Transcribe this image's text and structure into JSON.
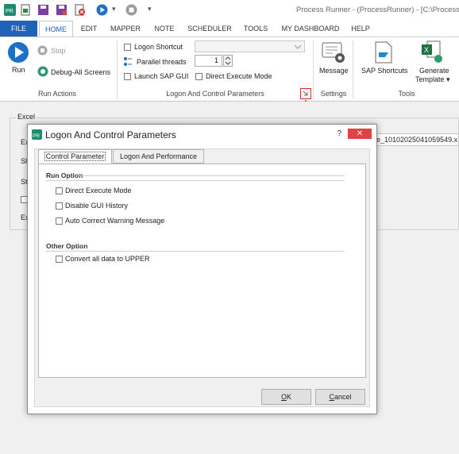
{
  "window": {
    "title": "Process Runner - (ProcessRunner) - [C:\\Process Runn"
  },
  "quick_access": {
    "icons": [
      "app-logo-icon",
      "new-file-icon",
      "save-icon",
      "save-as-icon",
      "delete-file-icon",
      "run-icon",
      "stop-icon",
      "customize-icon"
    ],
    "dropdown_glyph": "▾",
    "separator_glyph": "•"
  },
  "tabs": [
    "FILE",
    "HOME",
    "EDIT",
    "MAPPER",
    "NOTE",
    "SCHEDULER",
    "TOOLS",
    "MY DASHBOARD",
    "HELP"
  ],
  "ribbon": {
    "run_actions": {
      "label": "Run Actions",
      "run": "Run",
      "stop": "Stop",
      "debug": "Debug-All Screens"
    },
    "logon": {
      "label": "Logon And Control Parameters",
      "logon_shortcut": "Logon Shortcut",
      "parallel_threads": "Parallel threads",
      "threads_value": "1",
      "launch_sap_gui": "Launch SAP GUI",
      "direct_execute": "Direct Execute Mode"
    },
    "settings": {
      "label": "Settings",
      "message": "Message"
    },
    "tools": {
      "label": "Tools",
      "sap_shortcuts": "SAP Shortcuts",
      "generate_template": "Generate",
      "generate_template2": "Template ▾"
    }
  },
  "workspace": {
    "group_label": "Excel",
    "row_labels": [
      "Ex",
      "Sh",
      "St",
      "",
      "Ex"
    ],
    "file_text": "ne_10102025041059549.x"
  },
  "dialog": {
    "title": "Logon And Control Parameters",
    "help": "?",
    "close": "✕",
    "tabs": [
      "Control Parameter",
      "Logon And Performance"
    ],
    "run_option": {
      "title": "Run Option",
      "items": [
        "Direct Execute Mode",
        "Disable GUI History",
        "Auto Correct Warning Message"
      ]
    },
    "other_option": {
      "title": "Other Option",
      "items": [
        "Convert all data to UPPER"
      ]
    },
    "ok_rest": "K",
    "ok_mnemonic": "O",
    "cancel_rest": "ancel",
    "cancel_mnemonic": "C"
  },
  "colors": {
    "accent": "#1e64b4",
    "close_red": "#e04343",
    "arrow_red": "#d22b2b",
    "run_blue": "#1e6fc8"
  }
}
